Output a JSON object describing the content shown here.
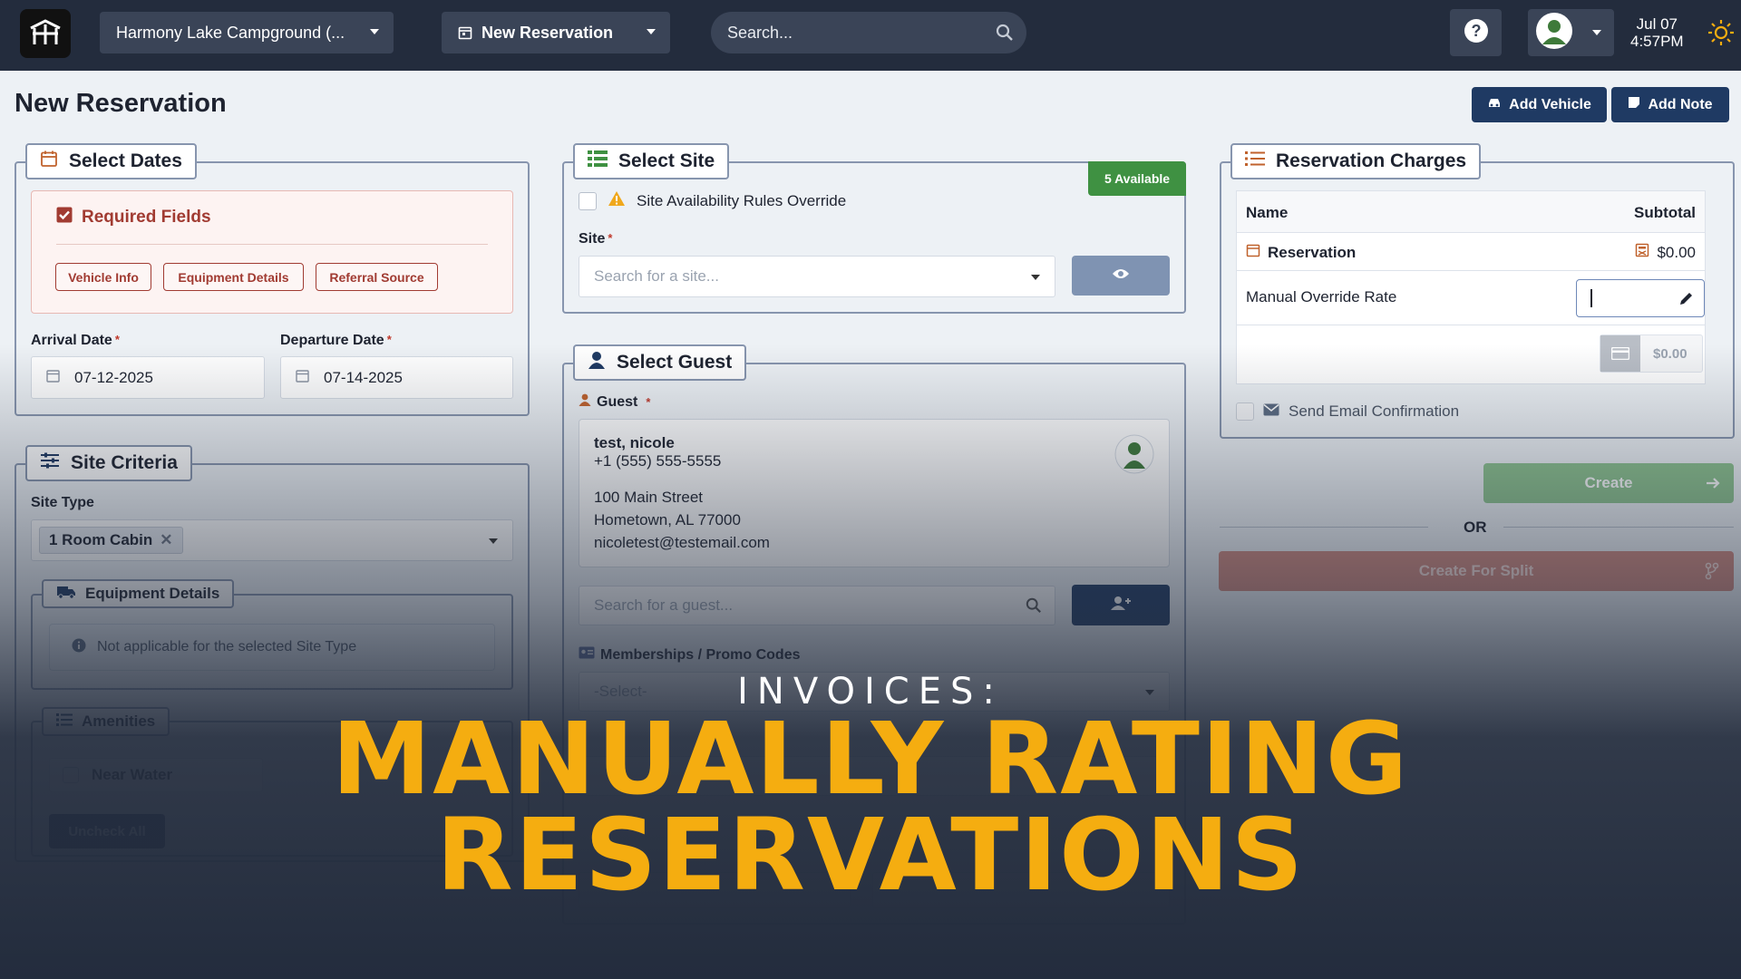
{
  "topbar": {
    "campground": "Harmony Lake Campground (...",
    "reservation_menu": "New Reservation",
    "search_placeholder": "Search...",
    "date": "Jul 07",
    "time": "4:57PM"
  },
  "page": {
    "title": "New Reservation",
    "add_vehicle": "Add Vehicle",
    "add_note": "Add Note"
  },
  "select_dates": {
    "title": "Select Dates",
    "required_title": "Required Fields",
    "chips": [
      "Vehicle Info",
      "Equipment Details",
      "Referral Source"
    ],
    "arrival_label": "Arrival Date",
    "arrival_value": "07-12-2025",
    "departure_label": "Departure Date",
    "departure_value": "07-14-2025"
  },
  "site_criteria": {
    "title": "Site Criteria",
    "site_type_label": "Site Type",
    "site_type_tag": "1 Room Cabin",
    "equipment_title": "Equipment Details",
    "equipment_note": "Not applicable for the selected Site Type",
    "amenities_title": "Amenities",
    "amenity_item": "Near Water",
    "uncheck_all": "Uncheck All"
  },
  "select_site": {
    "title": "Select Site",
    "available_badge": "5 Available",
    "override_label": "Site Availability Rules Override",
    "site_label": "Site",
    "site_placeholder": "Search for a site..."
  },
  "select_guest": {
    "title": "Select Guest",
    "guest_label": "Guest",
    "guest_name": "test, nicole",
    "guest_phone": "+1 (555) 555-5555",
    "address_line1": "100 Main Street",
    "address_line2": "Hometown, AL 77000",
    "email": "nicoletest@testemail.com",
    "guest_search_placeholder": "Search for a guest...",
    "memberships_label": "Memberships / Promo Codes",
    "memberships_placeholder": "-Select-"
  },
  "charges": {
    "title": "Reservation Charges",
    "col_name": "Name",
    "col_subtotal": "Subtotal",
    "reservation_label": "Reservation",
    "reservation_amount": "$0.00",
    "override_label": "Manual Override Rate",
    "total_amount": "$0.00",
    "email_confirm_label": "Send Email Confirmation",
    "create_label": "Create",
    "or_label": "OR",
    "create_split_label": "Create For Split"
  },
  "overlay": {
    "kicker": "INVOICES:",
    "line1": "MANUALLY RATING",
    "line2": "RESERVATIONS"
  },
  "colors": {
    "topbar": "#232c3d",
    "primary_dark": "#1f3a63",
    "success": "#3f9142",
    "danger": "#a13b32",
    "accent_title": "#f5ad10"
  },
  "icons": [
    "app-logo-icon",
    "calendar-icon",
    "search-icon",
    "help-icon",
    "avatar-icon",
    "sun-icon",
    "car-icon",
    "note-icon",
    "checkbox-icon",
    "sliders-icon",
    "truck-icon",
    "info-icon",
    "list-icon",
    "grid-icon",
    "warning-icon",
    "eye-icon",
    "user-icon",
    "user-plus-icon",
    "id-card-icon",
    "pencil-icon",
    "card-icon",
    "envelope-icon",
    "arrow-right-icon",
    "branch-icon"
  ]
}
